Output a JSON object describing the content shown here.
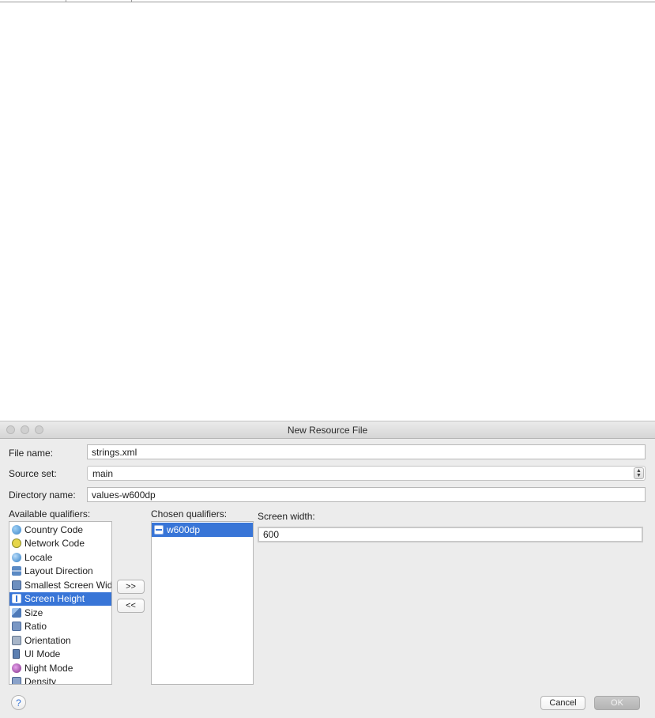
{
  "dialog": {
    "title": "New Resource File",
    "file_name_label": "File name:",
    "file_name_value": "strings.xml",
    "source_set_label": "Source set:",
    "source_set_value": "main",
    "directory_name_label": "Directory name:",
    "directory_name_value": "values-w600dp",
    "available_label": "Available qualifiers:",
    "chosen_label": "Chosen qualifiers:",
    "screen_width_label": "Screen width:",
    "screen_width_value": "600",
    "add_button": ">>",
    "remove_button": "<<",
    "help_button": "?",
    "cancel_button": "Cancel",
    "ok_button": "OK"
  },
  "available_qualifiers": [
    {
      "label": "Country Code",
      "icon": "globe-icon",
      "selected": false
    },
    {
      "label": "Network Code",
      "icon": "network-icon",
      "selected": false
    },
    {
      "label": "Locale",
      "icon": "locale-icon",
      "selected": false
    },
    {
      "label": "Layout Direction",
      "icon": "layout-direction-icon",
      "selected": false
    },
    {
      "label": "Smallest Screen Wid",
      "icon": "smallest-screen-icon",
      "selected": false
    },
    {
      "label": "Screen Height",
      "icon": "screen-height-icon",
      "selected": true
    },
    {
      "label": "Size",
      "icon": "size-icon",
      "selected": false
    },
    {
      "label": "Ratio",
      "icon": "ratio-icon",
      "selected": false
    },
    {
      "label": "Orientation",
      "icon": "orientation-icon",
      "selected": false
    },
    {
      "label": "UI Mode",
      "icon": "ui-mode-icon",
      "selected": false
    },
    {
      "label": "Night Mode",
      "icon": "night-mode-icon",
      "selected": false
    },
    {
      "label": "Density",
      "icon": "density-icon",
      "selected": false
    }
  ],
  "chosen_qualifiers": [
    {
      "label": "w600dp",
      "icon": "screen-width-icon",
      "selected": true
    }
  ],
  "colors": {
    "selection": "#3875d7",
    "dialog_bg": "#ececec"
  }
}
